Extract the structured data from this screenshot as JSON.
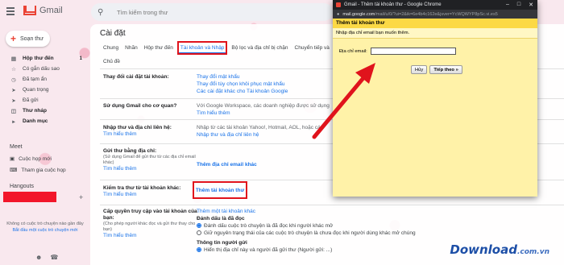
{
  "app": {
    "name": "Gmail"
  },
  "search": {
    "placeholder": "Tìm kiếm trong thư"
  },
  "compose": {
    "label": "Soạn thư"
  },
  "sidebar": {
    "items": [
      {
        "label": "Hộp thư đến",
        "count": "1",
        "bold": true
      },
      {
        "label": "Có gắn dấu sao",
        "count": ""
      },
      {
        "label": "Đã tạm ẩn",
        "count": ""
      },
      {
        "label": "Quan trọng",
        "count": ""
      },
      {
        "label": "Đã gửi",
        "count": ""
      },
      {
        "label": "Thư nháp",
        "count": "",
        "bold": true
      },
      {
        "label": "Danh mục",
        "count": "",
        "bold": true
      }
    ],
    "meet_title": "Meet",
    "meet_items": [
      "Cuộc họp mới",
      "Tham gia cuộc họp"
    ],
    "hangouts_title": "Hangouts",
    "empty_text": "Không có cuộc trò chuyện nào gần đây",
    "empty_link": "Bắt đầu một cuộc trò chuyện mới"
  },
  "settings": {
    "title": "Cài đặt",
    "tabs": [
      "Chung",
      "Nhãn",
      "Hộp thư đến",
      "Tài khoản và Nhập",
      "Bộ lọc và địa chỉ bị chặn",
      "Chuyển tiếp và"
    ],
    "tab_row2": "Chủ đề",
    "active_tab": "Tài khoản và Nhập",
    "rows": {
      "change": {
        "label": "Thay đổi cài đặt tài khoản:",
        "links": [
          "Thay đổi mật khẩu",
          "Thay đổi tùy chọn khôi phục mật khẩu",
          "Các cài đặt khác cho Tài khoản Google"
        ]
      },
      "workspace": {
        "label": "Sử dụng Gmail cho cơ quan?",
        "text": "Với Google Workspace, các doanh nghiệp được sử dụng",
        "link": "Tìm hiểu thêm"
      },
      "import": {
        "label": "Nhập thư và địa chỉ liên hệ:",
        "link": "Tìm hiểu thêm",
        "text": "Nhập từ các tài khoản Yahoo!, Hotmail, AOL, hoặc các",
        "action": "Nhập thư và địa chỉ liên hệ"
      },
      "sendas": {
        "label": "Gửi thư bằng địa chỉ:",
        "note": "(Sử dụng Gmail để gửi thư từ các địa chỉ email khác)",
        "link": "Tìm hiểu thêm",
        "action": "Thêm địa chỉ email khác"
      },
      "check": {
        "label": "Kiểm tra thư từ tài khoản khác:",
        "link": "Tìm hiểu thêm",
        "action": "Thêm tài khoản thư"
      },
      "grant": {
        "label": "Cấp quyền truy cập vào tài khoản của bạn:",
        "note": "(Cho phép người khác đọc và gửi thư thay cho bạn)",
        "link": "Tìm hiểu thêm",
        "action": "Thêm một tài khoản khác",
        "mark_read_title": "Đánh dấu là đã đọc",
        "option1": "Đánh dấu cuộc trò chuyện là đã đọc khi người khác mở",
        "option2": "Giữ nguyên trạng thái của các cuộc trò chuyện là chưa đọc khi người dùng khác mở chúng",
        "sender_title": "Thông tin người gửi",
        "sender_option": "Hiển thị địa chỉ này và người đã gửi thư (Người gửi: ...)"
      }
    }
  },
  "popup": {
    "window_title": "Gmail - Thêm tài khoản thư - Google Chrome",
    "url_host": "mail.google.com",
    "url_rest": "/mail/u/0/?ui=2&ik=6e4b4c162e&jsver=YcWQWYP8pSc.vi.es5",
    "header": "Thêm tài khoản thư",
    "subtitle": "Nhập địa chỉ email bạn muốn thêm.",
    "email_label": "Địa chỉ email:",
    "email_value": "",
    "cancel_label": "Hủy",
    "next_label": "Tiếp theo »"
  },
  "watermark": {
    "text": "Download",
    "ext": ".com.vn"
  },
  "colors": {
    "accent": "#1a73e8",
    "highlight": "#e0131c",
    "popup_bg": "#fff2a8",
    "popup_header": "#fcd945"
  }
}
